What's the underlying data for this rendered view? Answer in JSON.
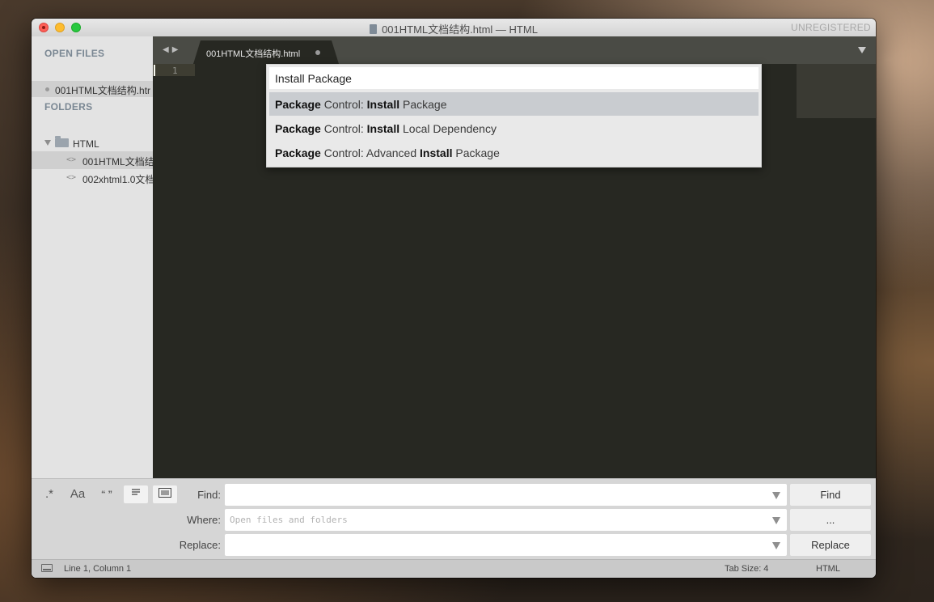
{
  "window": {
    "title": "001HTML文档结构.html — HTML",
    "unregistered": "UNREGISTERED"
  },
  "sidebar": {
    "open_files_heading": "OPEN FILES",
    "open_file": "001HTML文档结构.htr",
    "folders_heading": "FOLDERS",
    "folder_name": "HTML",
    "files": [
      {
        "label": "001HTML文档结",
        "selected": true
      },
      {
        "label": "002xhtml1.0文档",
        "selected": false
      }
    ]
  },
  "editor": {
    "tab_label": "001HTML文档结构.html",
    "line_number": "1"
  },
  "palette": {
    "input_value": "Install Package",
    "items": [
      {
        "parts": [
          [
            "b",
            "Package"
          ],
          [
            "t",
            " Control: "
          ],
          [
            "b",
            "Install"
          ],
          [
            "t",
            " Package"
          ]
        ],
        "selected": true
      },
      {
        "parts": [
          [
            "b",
            "Package"
          ],
          [
            "t",
            " Control: "
          ],
          [
            "b",
            "Install"
          ],
          [
            "t",
            " Local Dependency"
          ]
        ],
        "selected": false
      },
      {
        "parts": [
          [
            "b",
            "Package"
          ],
          [
            "t",
            " Control: Advanced "
          ],
          [
            "b",
            "Install"
          ],
          [
            "t",
            " Package"
          ]
        ],
        "selected": false
      }
    ]
  },
  "find_panel": {
    "options": {
      "regex": ".*",
      "case": "Aa",
      "whole_word": "“ ”"
    },
    "find_label": "Find:",
    "where_label": "Where:",
    "replace_label": "Replace:",
    "where_placeholder": "Open files and folders",
    "find_button": "Find",
    "where_button": "...",
    "replace_button": "Replace"
  },
  "status": {
    "position": "Line 1, Column 1",
    "tab_size": "Tab Size: 4",
    "syntax": "HTML"
  },
  "colors": {
    "editor_bg": "#272822",
    "tabbar_bg": "#4a4b45",
    "sidebar_bg": "#e3e3e3"
  }
}
